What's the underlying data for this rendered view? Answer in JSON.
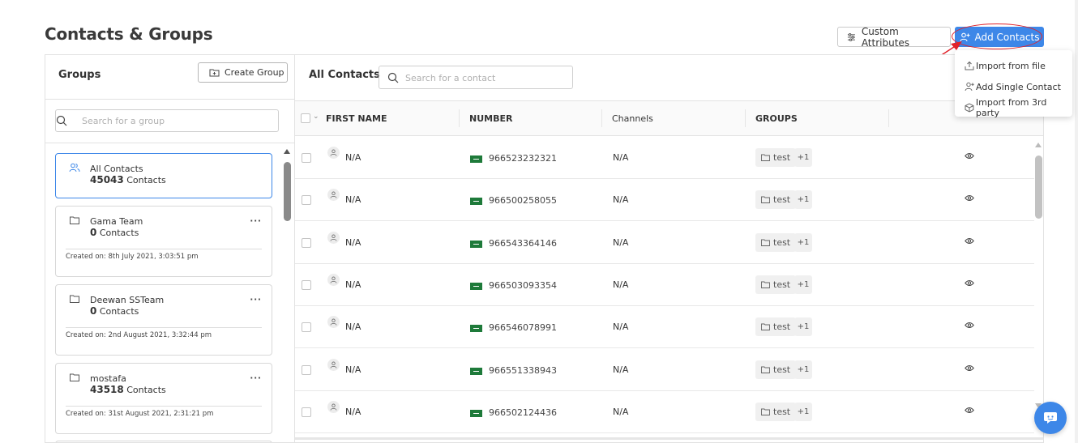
{
  "page": {
    "title": "Contacts & Groups"
  },
  "toolbar": {
    "custom_attributes_label": "Custom Attributes",
    "add_contacts_label": "Add Contacts"
  },
  "add_menu": {
    "items": [
      {
        "label": "Import from file",
        "icon": "upload-icon"
      },
      {
        "label": "Add Single Contact",
        "icon": "add-user-icon"
      },
      {
        "label": "Import from 3rd party",
        "icon": "cube-icon"
      }
    ]
  },
  "groups": {
    "title": "Groups",
    "create_label": "Create Group",
    "search_placeholder": "Search for a group",
    "items": [
      {
        "name": "All Contacts",
        "count": "45043",
        "count_suffix": "Contacts",
        "created": "",
        "active": true
      },
      {
        "name": "Gama Team",
        "count": "0",
        "count_suffix": "Contacts",
        "created": "Created on: 8th July 2021, 3:03:51 pm"
      },
      {
        "name": "Deewan SSTeam",
        "count": "0",
        "count_suffix": "Contacts",
        "created": "Created on: 2nd August 2021, 3:32:44 pm"
      },
      {
        "name": "mostafa",
        "count": "43518",
        "count_suffix": "Contacts",
        "created": "Created on: 31st August 2021, 2:31:21 pm"
      }
    ]
  },
  "contacts": {
    "title": "All Contacts",
    "search_placeholder": "Search for a contact",
    "columns": [
      "FIRST NAME",
      "NUMBER",
      "Channels",
      "GROUPS"
    ],
    "rows": [
      {
        "first_name": "N/A",
        "number": "966523232321",
        "channels": "N/A",
        "group": "test",
        "more": "+1"
      },
      {
        "first_name": "N/A",
        "number": "966500258055",
        "channels": "N/A",
        "group": "test",
        "more": "+1"
      },
      {
        "first_name": "N/A",
        "number": "966543364146",
        "channels": "N/A",
        "group": "test",
        "more": "+1"
      },
      {
        "first_name": "N/A",
        "number": "966503093354",
        "channels": "N/A",
        "group": "test",
        "more": "+1"
      },
      {
        "first_name": "N/A",
        "number": "966546078991",
        "channels": "N/A",
        "group": "test",
        "more": "+1"
      },
      {
        "first_name": "N/A",
        "number": "966551338943",
        "channels": "N/A",
        "group": "test",
        "more": "+1"
      },
      {
        "first_name": "N/A",
        "number": "966502124436",
        "channels": "N/A",
        "group": "test",
        "more": "+1"
      }
    ]
  },
  "colors": {
    "accent": "#3d87e8",
    "annotation": "#e1222a",
    "flag": "#1e7a3a"
  }
}
